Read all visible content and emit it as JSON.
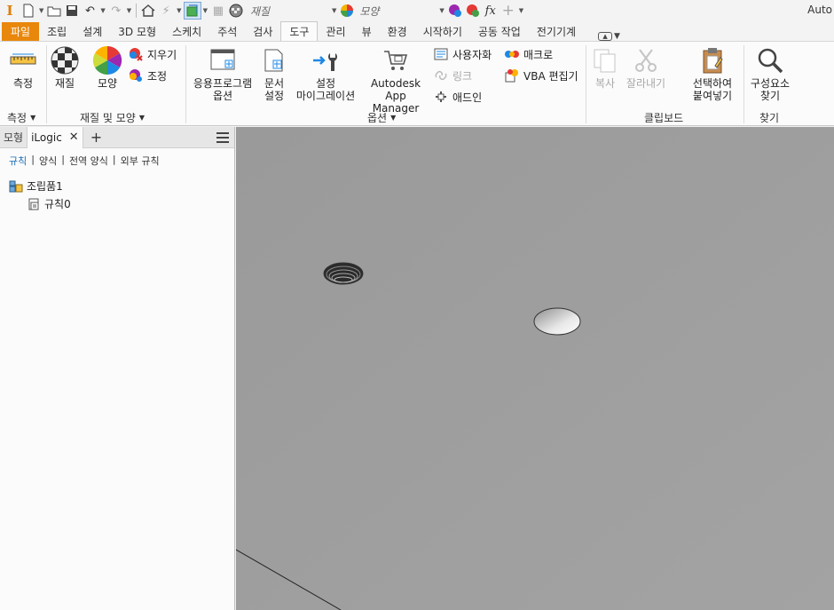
{
  "qat": {
    "app_logo": "I",
    "material_combo": "재질",
    "appearance_combo": "모양",
    "window_title": "Auto"
  },
  "tabs": [
    {
      "label": "파일"
    },
    {
      "label": "조립"
    },
    {
      "label": "설계"
    },
    {
      "label": "3D 모형"
    },
    {
      "label": "스케치"
    },
    {
      "label": "주석"
    },
    {
      "label": "검사"
    },
    {
      "label": "도구"
    },
    {
      "label": "관리"
    },
    {
      "label": "뷰"
    },
    {
      "label": "환경"
    },
    {
      "label": "시작하기"
    },
    {
      "label": "공동 작업"
    },
    {
      "label": "전기기계"
    }
  ],
  "ribbon": {
    "measure": {
      "label": "측정",
      "panel": "측정"
    },
    "material": {
      "label": "재질"
    },
    "appearance": {
      "label": "모양"
    },
    "clear": {
      "label": "지우기"
    },
    "adjust": {
      "label": "조정"
    },
    "material_panel": "재질 및 모양",
    "app_options": {
      "line1": "응용프로그램",
      "line2": "옵션"
    },
    "doc_settings": {
      "line1": "문서",
      "line2": "설정"
    },
    "migrate": {
      "line1": "설정",
      "line2": "마이그레이션"
    },
    "app_manager": {
      "line1": "Autodesk",
      "line2": "App Manager"
    },
    "customize": {
      "label": "사용자화"
    },
    "link": {
      "label": "링크"
    },
    "addin": {
      "label": "애드인"
    },
    "macro": {
      "label": "매크로"
    },
    "vba": {
      "label": "VBA 편집기"
    },
    "options_panel": "옵션",
    "copy": {
      "label": "복사"
    },
    "cut": {
      "label": "잘라내기"
    },
    "paste_special": {
      "line1": "선택하여",
      "line2": "붙여넣기"
    },
    "clipboard_panel": "클립보드",
    "find_component": {
      "line1": "구성요소",
      "line2": "찾기"
    },
    "find_panel": "찾기"
  },
  "browser": {
    "tab_model": "모형",
    "tab_ilogic": "iLogic",
    "subtabs": [
      "규칙",
      "양식",
      "전역 양식",
      "외부 규칙"
    ],
    "tree": [
      {
        "label": "조립품1"
      },
      {
        "label": "규칙0"
      }
    ]
  }
}
